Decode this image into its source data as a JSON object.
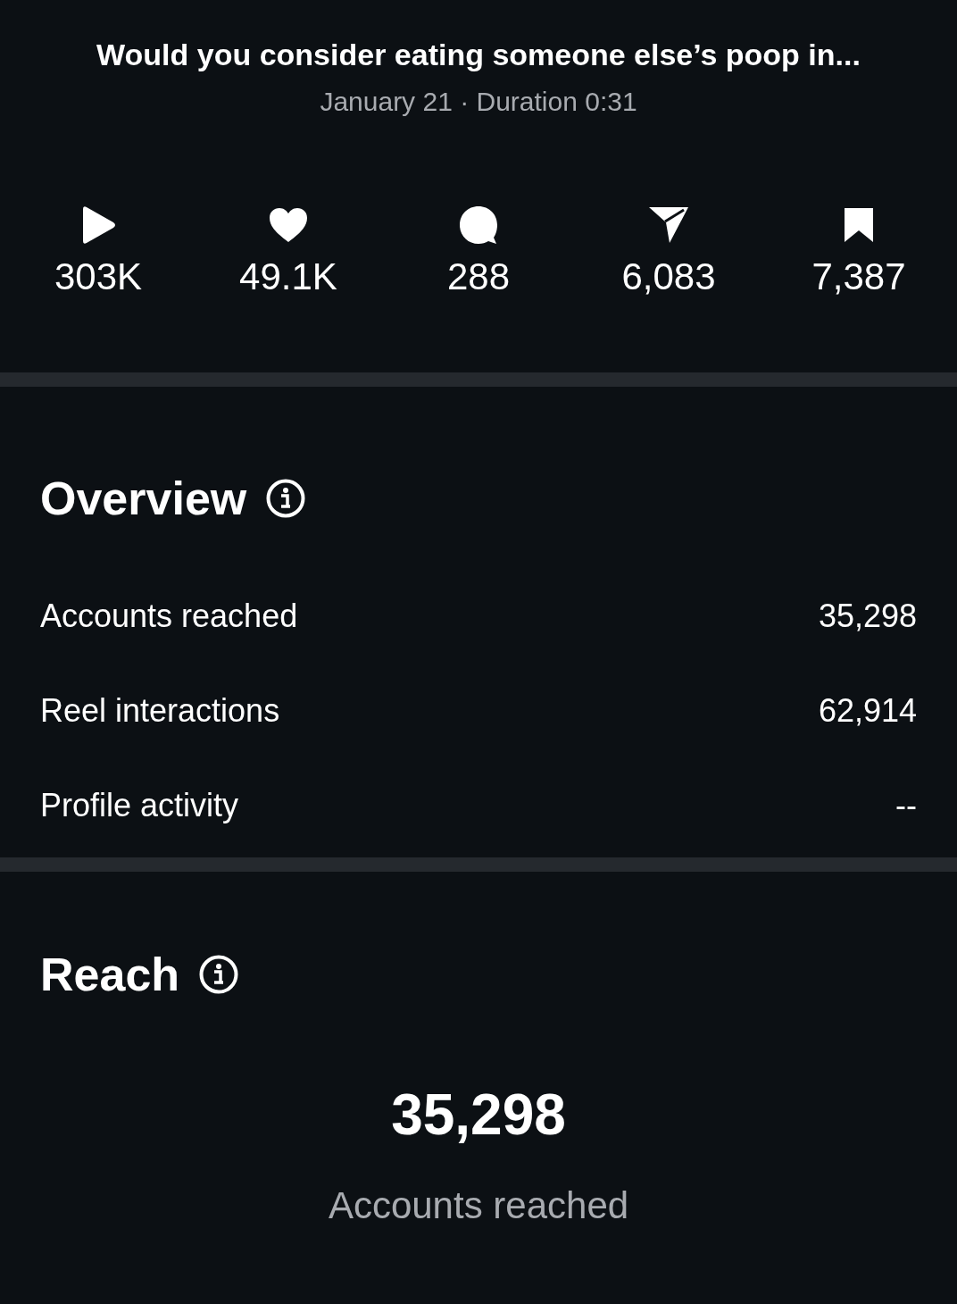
{
  "header": {
    "title": "Would you consider eating someone else’s poop in...",
    "subtitle": "January 21 · Duration 0:31"
  },
  "stats": [
    {
      "kind": "plays",
      "value": "303K"
    },
    {
      "kind": "likes",
      "value": "49.1K"
    },
    {
      "kind": "comments",
      "value": "288"
    },
    {
      "kind": "shares",
      "value": "6,083"
    },
    {
      "kind": "saves",
      "value": "7,387"
    }
  ],
  "overview": {
    "heading": "Overview",
    "rows": [
      {
        "label": "Accounts reached",
        "value": "35,298"
      },
      {
        "label": "Reel interactions",
        "value": "62,914"
      },
      {
        "label": "Profile activity",
        "value": "--"
      }
    ]
  },
  "reach": {
    "heading": "Reach",
    "value": "35,298",
    "caption": "Accounts reached"
  }
}
